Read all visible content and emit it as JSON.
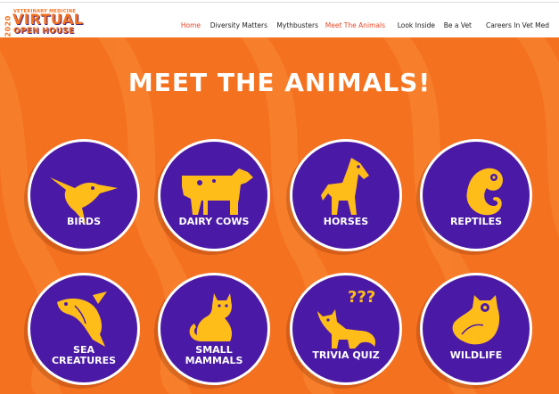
{
  "logo": {
    "year": "2020",
    "line1": "VETERINARY MEDICINE",
    "line2": "VIRTUAL",
    "line3": "OPEN HOUSE"
  },
  "nav": {
    "items": [
      {
        "label": "Home",
        "active": true
      },
      {
        "label": "Diversity Matters",
        "active": false
      },
      {
        "label": "Mythbusters",
        "active": false
      },
      {
        "label": "Meet The Animals",
        "active": true
      },
      {
        "label": "Look Inside",
        "active": false
      },
      {
        "label": "Be a Vet",
        "active": false
      },
      {
        "label": "Careers In Vet Med",
        "active": false
      }
    ]
  },
  "hero": {
    "title": "MEET THE ANIMALS!"
  },
  "cards": [
    {
      "label": "BIRDS",
      "icon": "bird-icon"
    },
    {
      "label": "DAIRY COWS",
      "icon": "cow-icon"
    },
    {
      "label": "HORSES",
      "icon": "horse-icon"
    },
    {
      "label": "REPTILES",
      "icon": "chameleon-icon"
    },
    {
      "label": "SEA\nCREATURES",
      "icon": "fish-icon"
    },
    {
      "label": "SMALL\nMAMMALS",
      "icon": "cat-icon"
    },
    {
      "label": "TRIVIA QUIZ",
      "icon": "fox-question-icon"
    },
    {
      "label": "WILDLIFE",
      "icon": "owl-icon"
    }
  ],
  "colors": {
    "brand_orange": "#f47120",
    "circle_purple": "#4a1aa6",
    "icon_yellow": "#ffbd1a",
    "nav_active": "#e8492a"
  }
}
